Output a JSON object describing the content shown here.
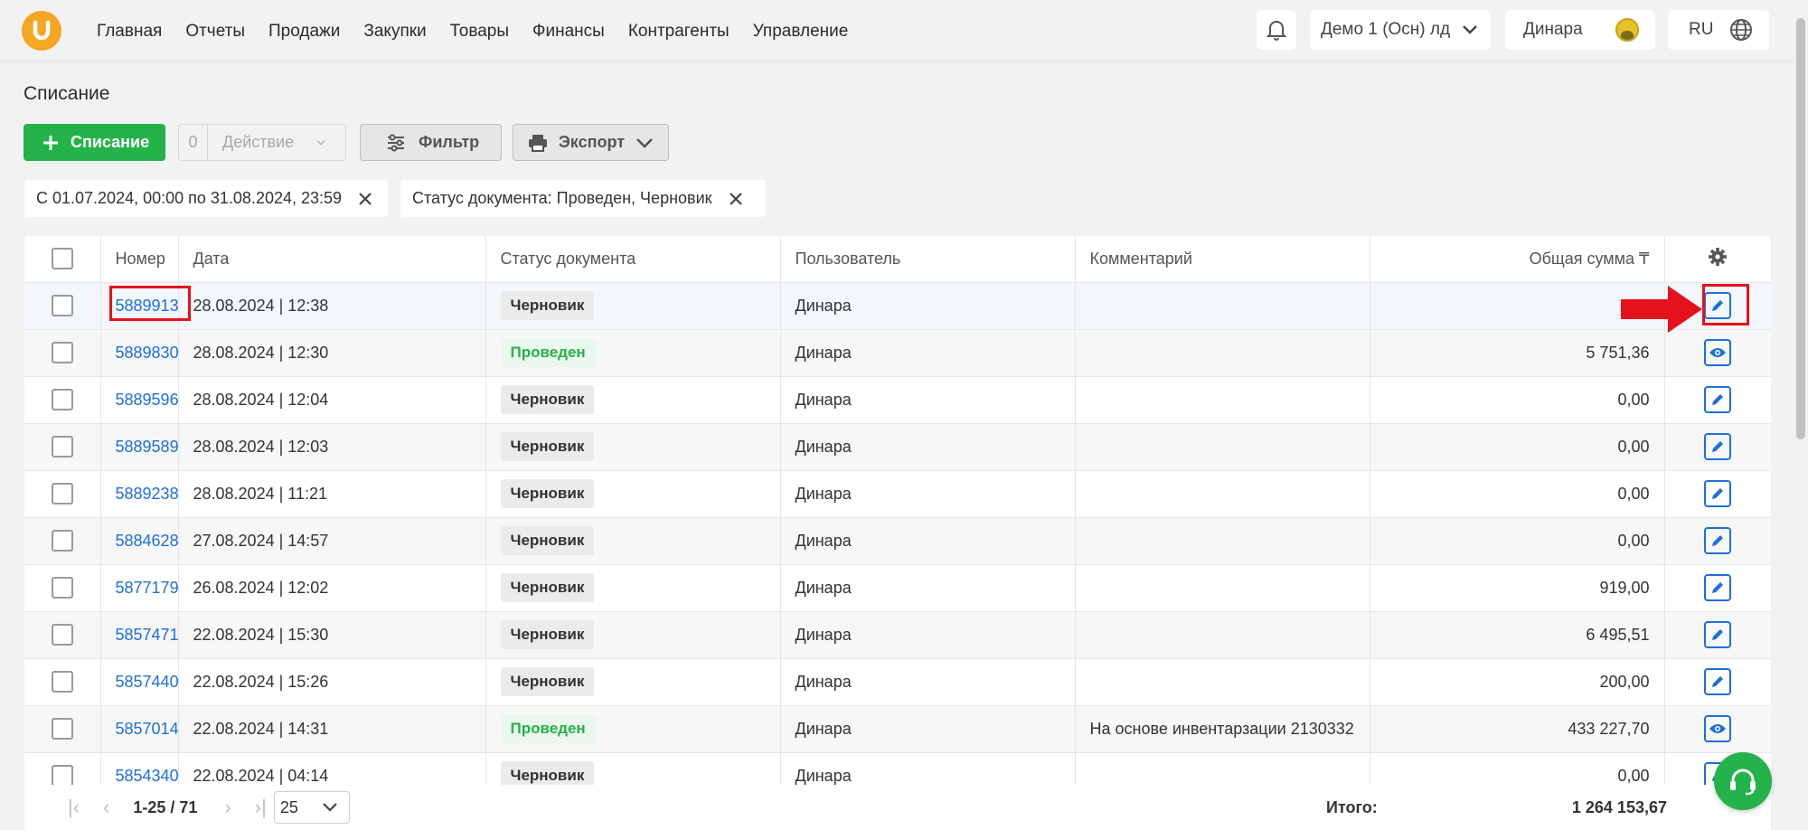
{
  "nav": {
    "items": [
      "Главная",
      "Отчеты",
      "Продажи",
      "Закупки",
      "Товары",
      "Финансы",
      "Контрагенты",
      "Управление"
    ],
    "company": "Демо 1 (Осн) лд",
    "user": "Динара",
    "lang": "RU"
  },
  "page_title": "Списание",
  "toolbar": {
    "add_label": "Списание",
    "action_count": "0",
    "action_label": "Действие",
    "filter_label": "Фильтр",
    "export_label": "Экспорт"
  },
  "chips": {
    "date": "С 01.07.2024, 00:00 по 31.08.2024, 23:59",
    "status": "Статус документа: Проведен, Черновик"
  },
  "table": {
    "headers": {
      "number": "Номер",
      "date": "Дата",
      "status": "Статус документа",
      "user": "Пользователь",
      "comment": "Комментарий",
      "total": "Общая сумма ₸"
    },
    "rows": [
      {
        "number": "5889913",
        "date": "28.08.2024 | 12:38",
        "status": "Черновик",
        "user": "Динара",
        "comment": "",
        "total": "",
        "action": "edit"
      },
      {
        "number": "5889830",
        "date": "28.08.2024 | 12:30",
        "status": "Проведен",
        "user": "Динара",
        "comment": "",
        "total": "5 751,36",
        "action": "view"
      },
      {
        "number": "5889596",
        "date": "28.08.2024 | 12:04",
        "status": "Черновик",
        "user": "Динара",
        "comment": "",
        "total": "0,00",
        "action": "edit"
      },
      {
        "number": "5889589",
        "date": "28.08.2024 | 12:03",
        "status": "Черновик",
        "user": "Динара",
        "comment": "",
        "total": "0,00",
        "action": "edit"
      },
      {
        "number": "5889238",
        "date": "28.08.2024 | 11:21",
        "status": "Черновик",
        "user": "Динара",
        "comment": "",
        "total": "0,00",
        "action": "edit"
      },
      {
        "number": "5884628",
        "date": "27.08.2024 | 14:57",
        "status": "Черновик",
        "user": "Динара",
        "comment": "",
        "total": "0,00",
        "action": "edit"
      },
      {
        "number": "5877179",
        "date": "26.08.2024 | 12:02",
        "status": "Черновик",
        "user": "Динара",
        "comment": "",
        "total": "919,00",
        "action": "edit"
      },
      {
        "number": "5857471",
        "date": "22.08.2024 | 15:30",
        "status": "Черновик",
        "user": "Динара",
        "comment": "",
        "total": "6 495,51",
        "action": "edit"
      },
      {
        "number": "5857440",
        "date": "22.08.2024 | 15:26",
        "status": "Черновик",
        "user": "Динара",
        "comment": "",
        "total": "200,00",
        "action": "edit"
      },
      {
        "number": "5857014",
        "date": "22.08.2024 | 14:31",
        "status": "Проведен",
        "user": "Динара",
        "comment": "На основе инвентарзации 2130332",
        "total": "433 227,70",
        "action": "view"
      },
      {
        "number": "5854340",
        "date": "22.08.2024 | 04:14",
        "status": "Черновик",
        "user": "Динара",
        "comment": "",
        "total": "0,00",
        "action": "edit"
      }
    ]
  },
  "footer": {
    "range": "1-25 / 71",
    "page_size": "25",
    "total_label": "Итого:",
    "total_value": "1 264 153,67"
  },
  "colors": {
    "brand_orange": "#f5a623",
    "accent_green": "#24b24b",
    "link_blue": "#1e6fd9",
    "highlight_red": "#e5121b"
  }
}
